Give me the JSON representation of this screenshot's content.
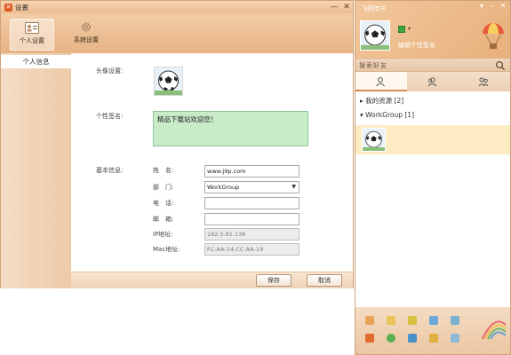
{
  "settings": {
    "title": "设置",
    "tabs": [
      {
        "label": "个人设置",
        "active": true
      },
      {
        "label": "系统设置",
        "active": false
      }
    ],
    "sidebar": {
      "items": [
        {
          "label": "个人信息"
        }
      ]
    },
    "labels": {
      "avatar": "头像设置:",
      "signature": "个性签名:",
      "basic_info": "基本信息:"
    },
    "signature_value": "精品下载站欢迎您！",
    "fields": [
      {
        "label": "姓　名:",
        "value": "www.j9p.com",
        "disabled": false
      },
      {
        "label": "部　门:",
        "value": "WorkGroup",
        "disabled": false,
        "dropdown": true
      },
      {
        "label": "电　话:",
        "value": "",
        "disabled": false
      },
      {
        "label": "邮　箱:",
        "value": "",
        "disabled": false
      },
      {
        "label": "IP地址:",
        "value": "192.5.91.136",
        "disabled": true
      },
      {
        "label": "Mac地址:",
        "value": "FC-AA-14-CC-AA-19",
        "disabled": true
      }
    ],
    "buttons": {
      "save": "保存",
      "cancel": "取消"
    }
  },
  "messenger": {
    "title": "飞鸽传书",
    "signature_placeholder": "编辑个性签名",
    "search_placeholder": "搜索好友",
    "groups": [
      {
        "label": "我的资源 [2]",
        "expanded": false
      },
      {
        "label": "WorkGroup [1]",
        "expanded": true
      }
    ]
  },
  "colors": {
    "accent": "#e8b384",
    "signature_bg": "#c8ebc8",
    "selected_row": "#fdebc4"
  }
}
